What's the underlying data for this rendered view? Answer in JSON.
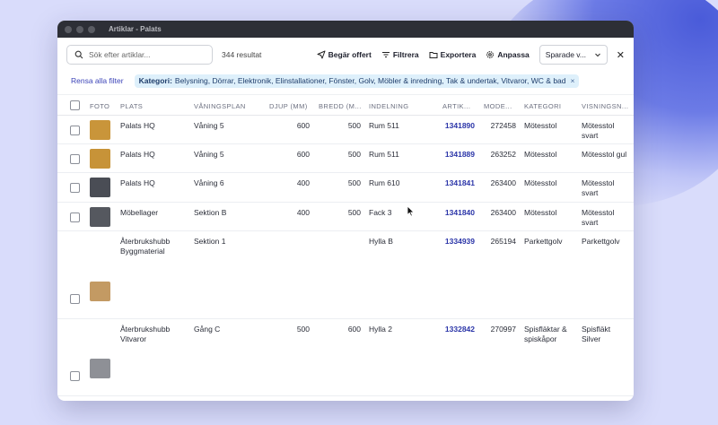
{
  "window": {
    "title": "Artiklar - Palats"
  },
  "toolbar": {
    "search_placeholder": "Sök efter artiklar...",
    "result_count": "344 resultat",
    "request_offer": "Begär offert",
    "filter": "Filtrera",
    "export": "Exportera",
    "customize": "Anpassa",
    "saved_views": "Sparade v...",
    "close": "✕"
  },
  "filters": {
    "clear_all": "Rensa alla filter",
    "chip_label": "Kategori:",
    "chip_value": "Belysning, Dörrar, Elektronik, Elinstallationer, Fönster, Golv, Möbler & inredning, Tak & undertak, Vitvaror, WC & bad",
    "chip_remove": "×"
  },
  "table": {
    "headers": [
      "FOTO",
      "PLATS",
      "VÅNINGSPLAN",
      "DJUP (MM)",
      "BREDD (M...",
      "INDELNING",
      "ARTIK...",
      "MODE...",
      "KATEGORI",
      "VISNINGSN..."
    ],
    "rows": [
      {
        "plats": "Palats HQ",
        "plats2": "",
        "vaning": "Våning 5",
        "djup": "600",
        "bredd": "500",
        "indelning": "Rum 511",
        "artikel": "1341890",
        "modell": "272458",
        "kategori": "Mötesstol",
        "kategori2": "",
        "visning": "Mötesstol",
        "visning2": "svart",
        "thumb_color": "#c9953a"
      },
      {
        "plats": "Palats HQ",
        "plats2": "",
        "vaning": "Våning 5",
        "djup": "600",
        "bredd": "500",
        "indelning": "Rum 511",
        "artikel": "1341889",
        "modell": "263252",
        "kategori": "Mötesstol",
        "kategori2": "",
        "visning": "Mötesstol gul",
        "visning2": "",
        "thumb_color": "#c79338"
      },
      {
        "plats": "Palats HQ",
        "plats2": "",
        "vaning": "Våning 6",
        "djup": "400",
        "bredd": "500",
        "indelning": "Rum 610",
        "artikel": "1341841",
        "modell": "263400",
        "kategori": "Mötesstol",
        "kategori2": "",
        "visning": "Mötesstol",
        "visning2": "svart",
        "thumb_color": "#4a4d55"
      },
      {
        "plats": "Möbellager",
        "plats2": "",
        "vaning": "Sektion B",
        "djup": "400",
        "bredd": "500",
        "indelning": "Fack 3",
        "artikel": "1341840",
        "modell": "263400",
        "kategori": "Mötesstol",
        "kategori2": "",
        "visning": "Mötesstol",
        "visning2": "svart",
        "thumb_color": "#55585f"
      },
      {
        "plats": "Återbrukshubb",
        "plats2": "Byggmaterial",
        "vaning": "Sektion 1",
        "djup": "",
        "bredd": "",
        "indelning": "Hylla B",
        "artikel": "1334939",
        "modell": "265194",
        "kategori": "Parkettgolv",
        "kategori2": "",
        "visning": "Parkettgolv",
        "visning2": "",
        "thumb_color": "#c39a63"
      },
      {
        "plats": "Återbrukshubb",
        "plats2": "Vitvaror",
        "vaning": "Gång C",
        "djup": "500",
        "bredd": "600",
        "indelning": "Hylla 2",
        "artikel": "1332842",
        "modell": "270997",
        "kategori": "Spisfläktar &",
        "kategori2": "spiskåpor",
        "visning": "Spisfläkt",
        "visning2": "Silver",
        "thumb_color": "#8e9096"
      }
    ]
  }
}
